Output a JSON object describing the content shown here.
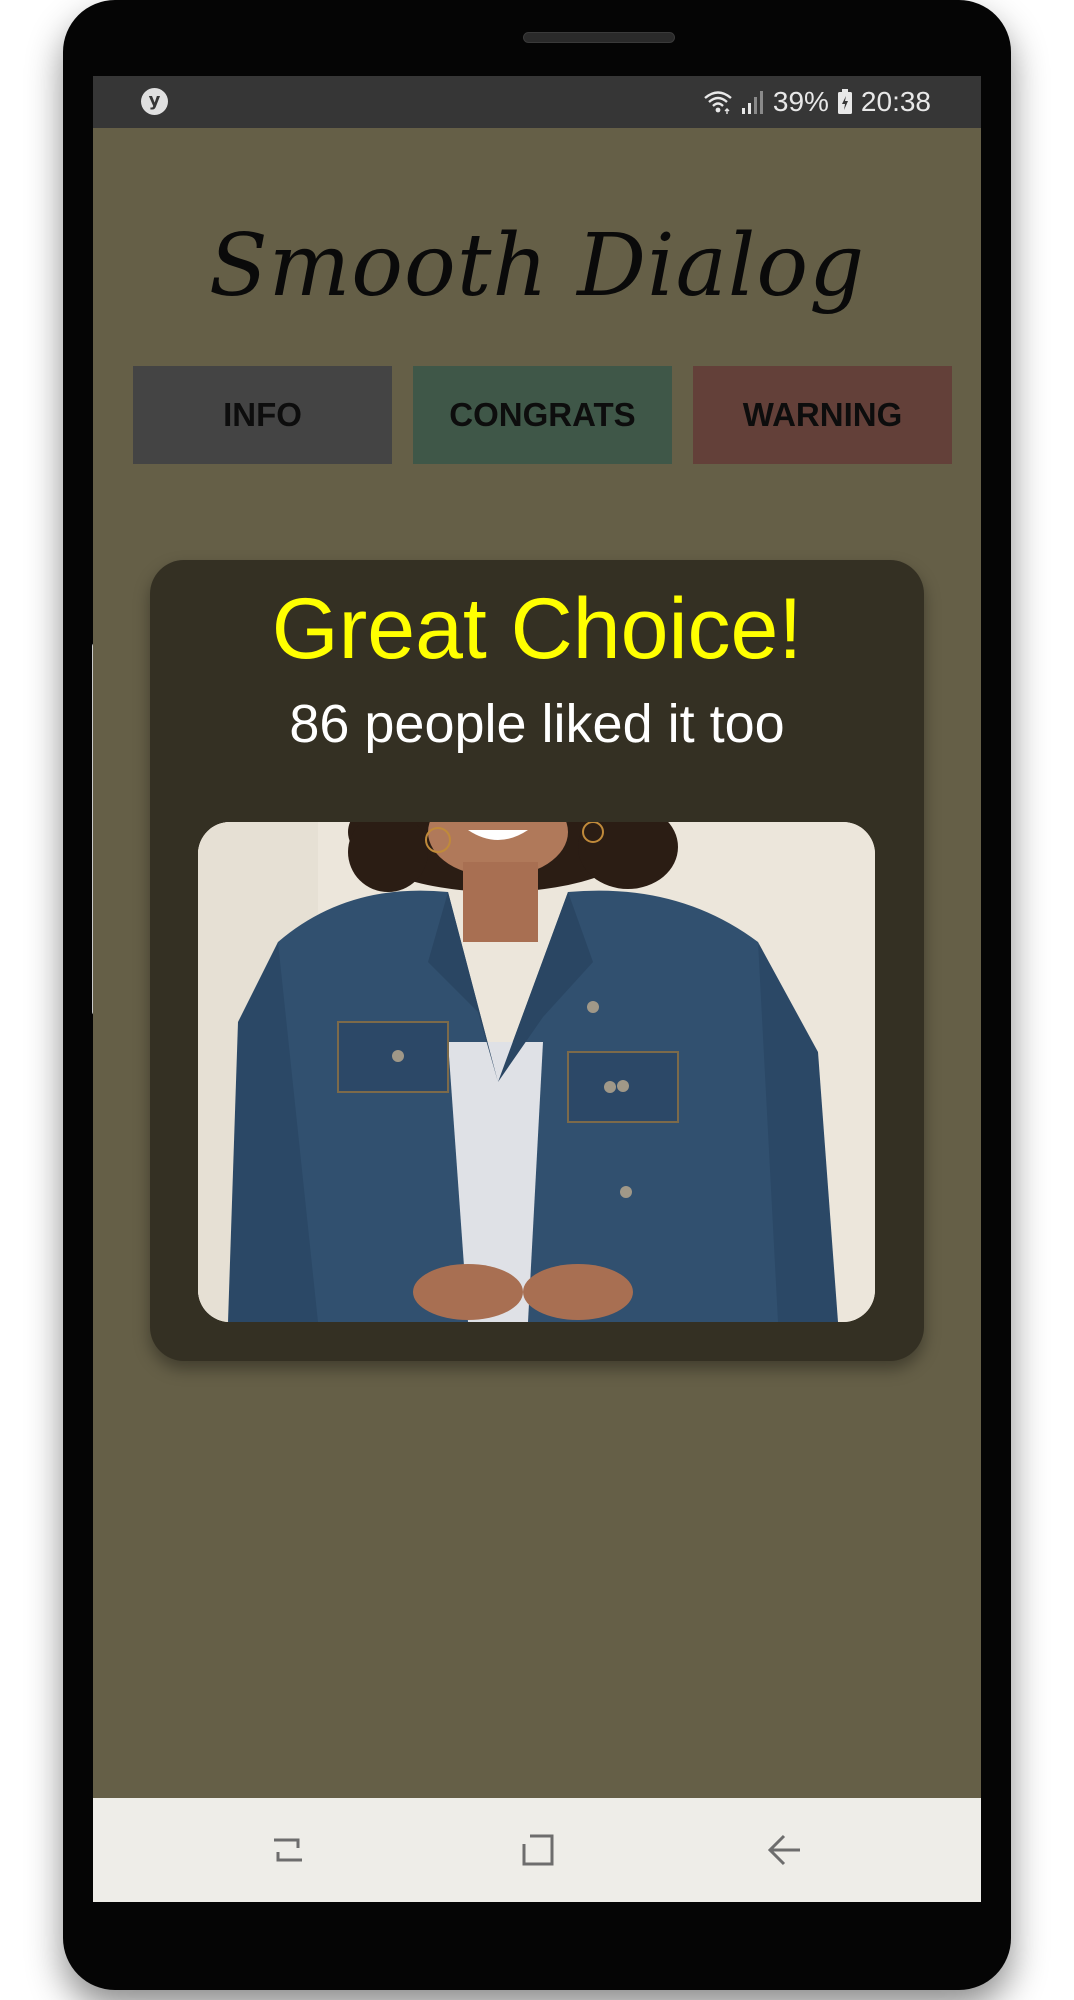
{
  "status_bar": {
    "app_icon_letter": "y",
    "battery_percent": "39%",
    "time": "20:38",
    "icons": [
      "wifi-icon",
      "signal-icon",
      "battery-icon"
    ]
  },
  "app": {
    "title": "Smooth Dialog",
    "buttons": [
      {
        "label": "INFO",
        "color": "#444444"
      },
      {
        "label": "CONGRATS",
        "color": "#3f5748"
      },
      {
        "label": "WARNING",
        "color": "#634039"
      }
    ],
    "background_color": "#655f47"
  },
  "dialog": {
    "title": "Great Choice!",
    "subtitle": "86 people liked it too",
    "title_color": "#ffff00",
    "background_color": "#343023",
    "image_icon": "denim-jacket-photo"
  },
  "nav_bar": {
    "icons": [
      "recents-icon",
      "home-icon",
      "back-icon"
    ]
  }
}
